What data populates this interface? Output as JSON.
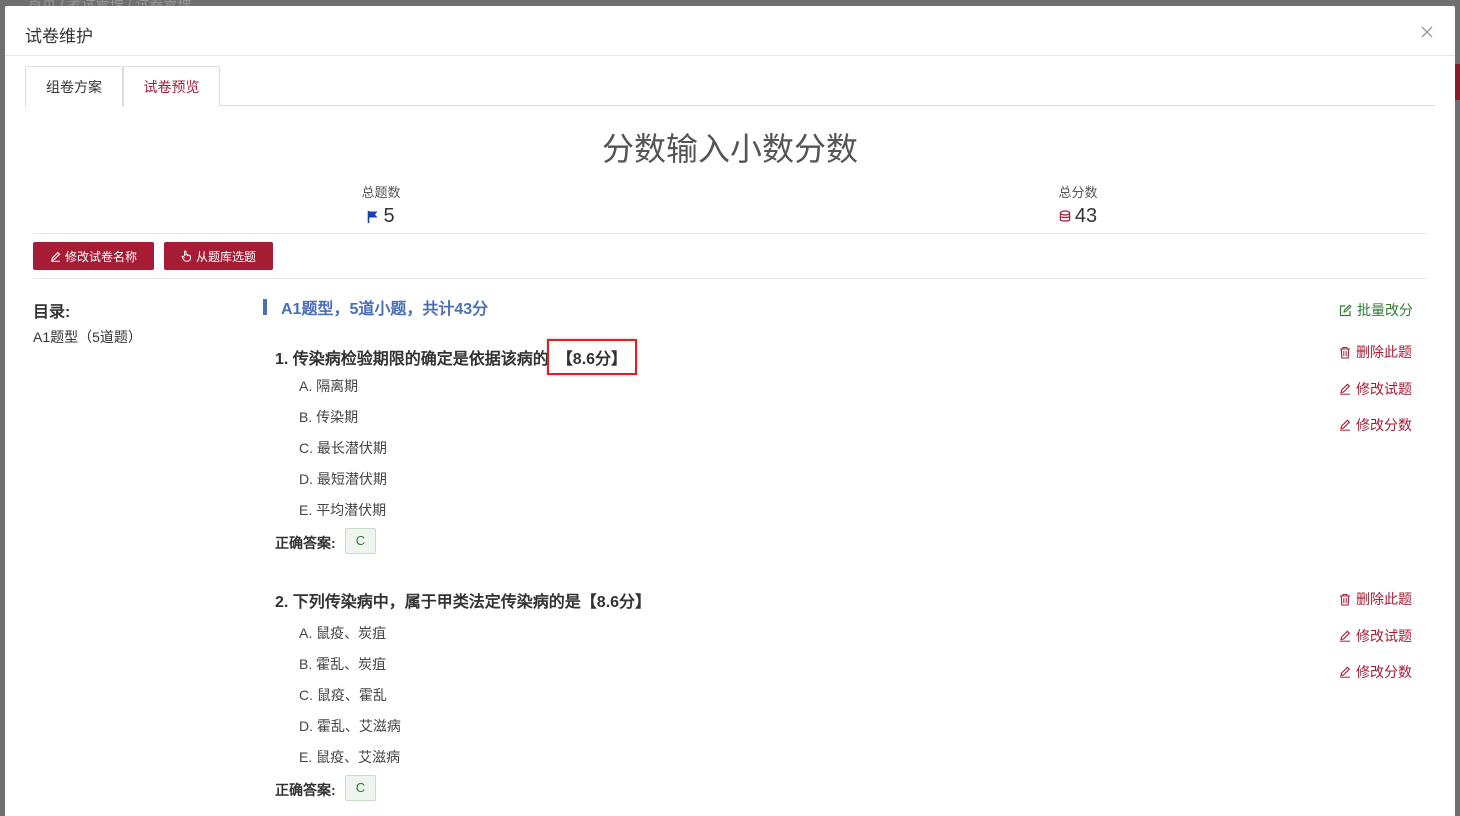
{
  "backdrop": {
    "breadcrumb": "首页 / 考试管理 / 试卷管理"
  },
  "modal": {
    "title": "试卷维护",
    "tabs": [
      {
        "label": "组卷方案"
      },
      {
        "label": "试卷预览"
      }
    ],
    "paper_title": "分数输入小数分数",
    "stats": {
      "total_questions_label": "总题数",
      "total_questions": "5",
      "total_score_label": "总分数",
      "total_score": "43"
    },
    "buttons": {
      "rename": "修改试卷名称",
      "pick_from_bank": "从题库选题"
    },
    "toc": {
      "title": "目录:",
      "items": [
        "A1题型（5道题）"
      ]
    },
    "section": {
      "heading": "A1题型，5道小题，共计43分",
      "batch_edit": "批量改分"
    },
    "actions": {
      "delete": "删除此题",
      "edit_question": "修改试题",
      "edit_score": "修改分数"
    },
    "questions": [
      {
        "title": "1. 传染病检验期限的确定是依据该病的",
        "score": "【8.6分】",
        "options": [
          "A. 隔离期",
          "B. 传染期",
          "C. 最长潜伏期",
          "D. 最短潜伏期",
          "E. 平均潜伏期"
        ],
        "answer_label": "正确答案:",
        "answer": "C"
      },
      {
        "title": "2. 下列传染病中，属于甲类法定传染病的是",
        "score": "【8.6分】",
        "options": [
          "A. 鼠疫、炭疽",
          "B. 霍乱、炭疽",
          "C. 鼠疫、霍乱",
          "D. 霍乱、艾滋病",
          "E. 鼠疫、艾滋病"
        ],
        "answer_label": "正确答案:",
        "answer": "C"
      }
    ]
  },
  "colors": {
    "primary": "#a61c35",
    "section": "#4a6fb5",
    "success": "#2e7d32",
    "highlight": "#e0201f"
  }
}
